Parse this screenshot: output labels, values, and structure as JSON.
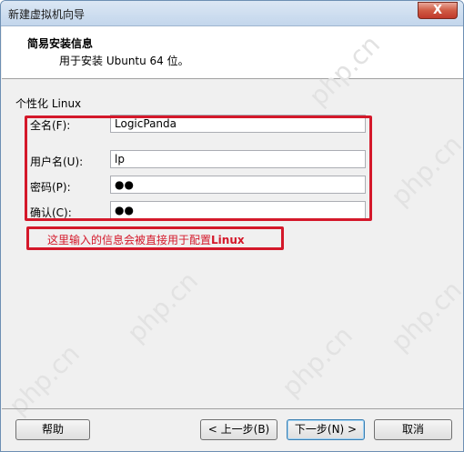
{
  "window": {
    "title": "新建虚拟机向导",
    "close_label": "X"
  },
  "header": {
    "title": "简易安装信息",
    "subtitle": "用于安装 Ubuntu 64 位。"
  },
  "group": {
    "label": "个性化 Linux"
  },
  "fields": {
    "fullname": {
      "label": "全名(F):",
      "value": "LogicPanda"
    },
    "username": {
      "label": "用户名(U):",
      "value": "lp"
    },
    "password": {
      "label": "密码(P):",
      "value": "●●"
    },
    "confirm": {
      "label": "确认(C):",
      "value": "●●"
    }
  },
  "annotation": {
    "text": "这里输入的信息会被直接用于配置",
    "bold": "Linux"
  },
  "buttons": {
    "help": "帮助",
    "back": "< 上一步(B)",
    "next": "下一步(N) >",
    "cancel": "取消"
  },
  "watermark": {
    "text": "php.cn"
  },
  "colors": {
    "annotation_red": "#d4182a",
    "titlebar": "#c3d6ec",
    "close": "#c0392b"
  }
}
